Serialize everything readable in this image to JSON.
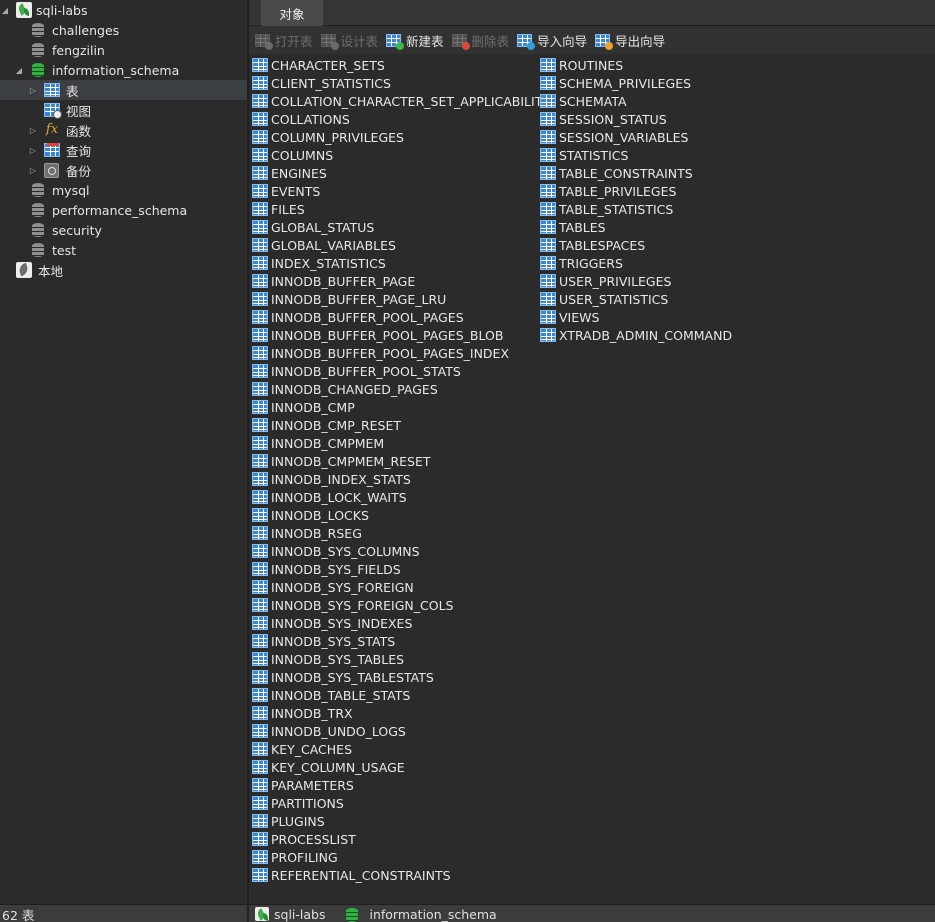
{
  "sidebar": {
    "connection": "sqli-labs",
    "databases": [
      "challenges",
      "fengzilin",
      "information_schema",
      "mysql",
      "performance_schema",
      "security",
      "test"
    ],
    "schema_children": [
      "表",
      "视图",
      "函数",
      "查询",
      "备份"
    ],
    "local": "本地"
  },
  "tabs": {
    "objects": "对象"
  },
  "toolbar": {
    "open_table": "打开表",
    "design_table": "设计表",
    "new_table": "新建表",
    "delete_table": "删除表",
    "import_wizard": "导入向导",
    "export_wizard": "导出向导"
  },
  "tables": [
    "CHARACTER_SETS",
    "CLIENT_STATISTICS",
    "COLLATION_CHARACTER_SET_APPLICABILITY",
    "COLLATIONS",
    "COLUMN_PRIVILEGES",
    "COLUMNS",
    "ENGINES",
    "EVENTS",
    "FILES",
    "GLOBAL_STATUS",
    "GLOBAL_VARIABLES",
    "INDEX_STATISTICS",
    "INNODB_BUFFER_PAGE",
    "INNODB_BUFFER_PAGE_LRU",
    "INNODB_BUFFER_POOL_PAGES",
    "INNODB_BUFFER_POOL_PAGES_BLOB",
    "INNODB_BUFFER_POOL_PAGES_INDEX",
    "INNODB_BUFFER_POOL_STATS",
    "INNODB_CHANGED_PAGES",
    "INNODB_CMP",
    "INNODB_CMP_RESET",
    "INNODB_CMPMEM",
    "INNODB_CMPMEM_RESET",
    "INNODB_INDEX_STATS",
    "INNODB_LOCK_WAITS",
    "INNODB_LOCKS",
    "INNODB_RSEG",
    "INNODB_SYS_COLUMNS",
    "INNODB_SYS_FIELDS",
    "INNODB_SYS_FOREIGN",
    "INNODB_SYS_FOREIGN_COLS",
    "INNODB_SYS_INDEXES",
    "INNODB_SYS_STATS",
    "INNODB_SYS_TABLES",
    "INNODB_SYS_TABLESTATS",
    "INNODB_TABLE_STATS",
    "INNODB_TRX",
    "INNODB_UNDO_LOGS",
    "KEY_CACHES",
    "KEY_COLUMN_USAGE",
    "PARAMETERS",
    "PARTITIONS",
    "PLUGINS",
    "PROCESSLIST",
    "PROFILING",
    "REFERENTIAL_CONSTRAINTS",
    "ROUTINES",
    "SCHEMA_PRIVILEGES",
    "SCHEMATA",
    "SESSION_STATUS",
    "SESSION_VARIABLES",
    "STATISTICS",
    "TABLE_CONSTRAINTS",
    "TABLE_PRIVILEGES",
    "TABLE_STATISTICS",
    "TABLES",
    "TABLESPACES",
    "TRIGGERS",
    "USER_PRIVILEGES",
    "USER_STATISTICS",
    "VIEWS",
    "XTRADB_ADMIN_COMMAND"
  ],
  "status": {
    "count": "62 表",
    "connection": "sqli-labs",
    "database": "information_schema"
  }
}
